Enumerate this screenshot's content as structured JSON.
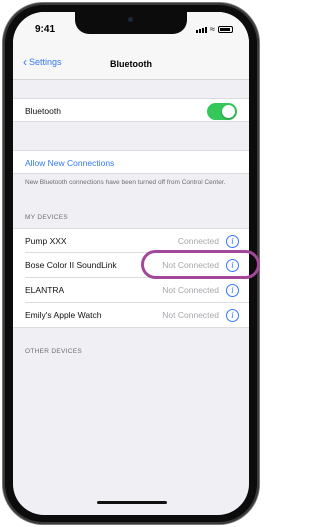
{
  "status_bar": {
    "time": "9:41",
    "icons": [
      "signal-icon",
      "wifi-icon",
      "battery-icon"
    ]
  },
  "nav": {
    "back_label": "Settings",
    "title": "Bluetooth"
  },
  "bluetooth_row": {
    "label": "Bluetooth",
    "toggle_on": true,
    "toggle_color": "#34c759"
  },
  "allow_connections": {
    "label": "Allow New Connections",
    "footnote": "New Bluetooth connections have been turned off from Control Center."
  },
  "my_devices": {
    "header": "MY DEVICES",
    "devices": [
      {
        "name": "Pump XXX",
        "status": "Connected"
      },
      {
        "name": "Bose Color II SoundLink",
        "status": "Not Connected"
      },
      {
        "name": "ELANTRA",
        "status": "Not Connected"
      },
      {
        "name": "Emily's Apple Watch",
        "status": "Not Connected"
      }
    ]
  },
  "other_devices": {
    "header": "OTHER DEVICES"
  },
  "colors": {
    "accent": "#3478f6",
    "highlight": "#a2479a",
    "toggle_on": "#34c759"
  }
}
